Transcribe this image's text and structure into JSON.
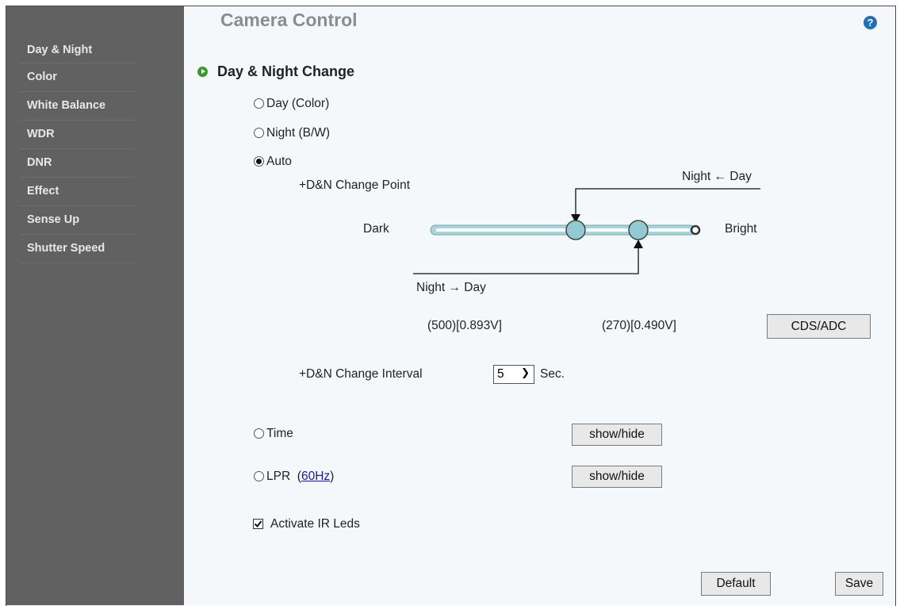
{
  "sidebar": {
    "items": [
      {
        "label": "Day & Night"
      },
      {
        "label": "Color"
      },
      {
        "label": "White Balance"
      },
      {
        "label": "WDR"
      },
      {
        "label": "DNR"
      },
      {
        "label": "Effect"
      },
      {
        "label": "Sense Up"
      },
      {
        "label": "Shutter Speed"
      }
    ]
  },
  "header": {
    "title": "Camera Control",
    "help_glyph": "?"
  },
  "section": {
    "title": "Day & Night Change"
  },
  "modes": {
    "day": "Day (Color)",
    "night": "Night (B/W)",
    "auto": "Auto",
    "time": "Time",
    "lpr": "LPR",
    "lpr_link_open": "(",
    "lpr_link": "60Hz",
    "lpr_link_close": ")",
    "selected": "auto"
  },
  "change_point": {
    "label": "+D&N Change Point",
    "left_label": "Dark",
    "right_label": "Bright",
    "night_from_day": "Night ← Day",
    "night_to_day": "Night → Day",
    "value_left": "(500)[0.893V]",
    "value_right": "(270)[0.490V]",
    "cds_button": "CDS/ADC"
  },
  "interval": {
    "label": "+D&N Change Interval",
    "value": "5",
    "unit": "Sec."
  },
  "buttons": {
    "show_hide": "show/hide",
    "default": "Default",
    "save": "Save"
  },
  "ir": {
    "label": "Activate IR Leds",
    "checked": true
  },
  "colors": {
    "sidebar_bg": "#616161",
    "main_bg": "#f4f8fb",
    "slider": "#a9d4db",
    "knob": "#93c9d1",
    "accent_bullet": "#3a9a2c",
    "help": "#1f6fb6"
  }
}
